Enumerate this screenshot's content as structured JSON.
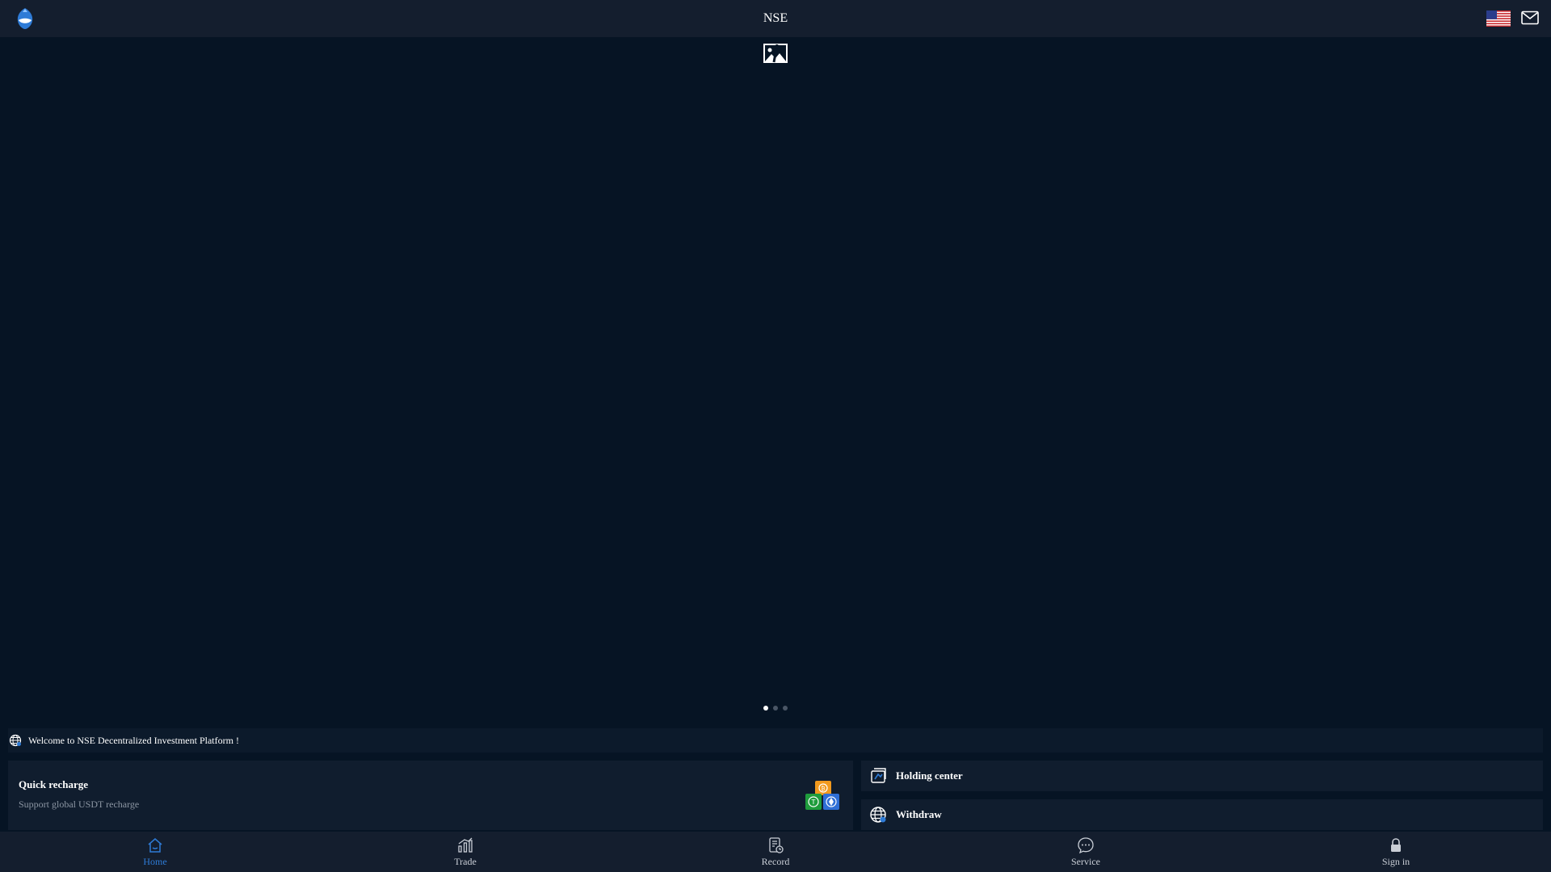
{
  "header": {
    "title": "NSE",
    "logo_icon": "whale-logo-icon",
    "flag_icon": "us-flag-icon",
    "mail_icon": "mail-icon"
  },
  "banner": {
    "image_icon": "broken-image-icon",
    "slides_total": 3,
    "active_slide": 1
  },
  "notice": {
    "icon": "globe-icon",
    "text": "Welcome to NSE Decentralized Investment Platform !"
  },
  "quick_recharge": {
    "title": "Quick recharge",
    "subtitle": "Support global USDT recharge",
    "icon": "crypto-coins-icon"
  },
  "side_links": [
    {
      "label": "Holding center",
      "icon": "holding-icon"
    },
    {
      "label": "Withdraw",
      "icon": "withdraw-globe-icon"
    }
  ],
  "tabs": [
    {
      "label": "Home",
      "icon": "home-icon",
      "active": true
    },
    {
      "label": "Trade",
      "icon": "chart-icon",
      "active": false
    },
    {
      "label": "Record",
      "icon": "record-icon",
      "active": false
    },
    {
      "label": "Service",
      "icon": "chat-icon",
      "active": false
    },
    {
      "label": "Sign in",
      "icon": "lock-icon",
      "active": false
    }
  ],
  "colors": {
    "background": "#061424",
    "header": "#141e2e",
    "card": "#101d2e",
    "accent": "#2e7bd6"
  }
}
